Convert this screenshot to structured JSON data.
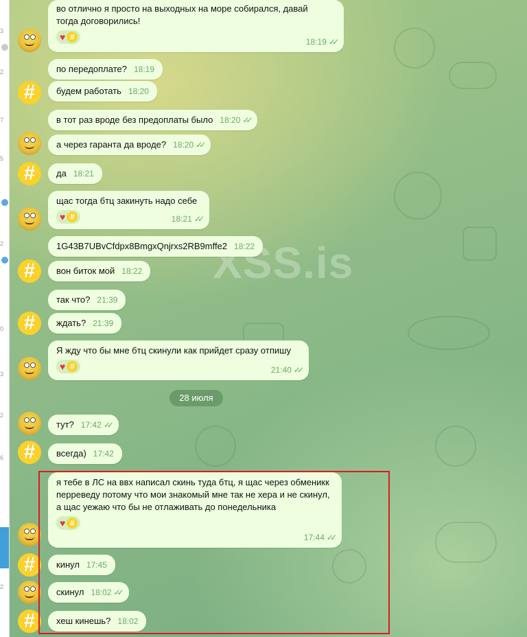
{
  "sidebar_strip": {
    "fragments": [
      "3",
      "2",
      "7",
      "5",
      "2",
      "0",
      "3",
      "2",
      "6",
      "2"
    ]
  },
  "watermark": "XSS.is",
  "date_separator": "28 июля",
  "highlight_color": "#e0191f",
  "messages": [
    {
      "id": "m1",
      "avatar": "sponge",
      "text": "во отлично я просто на выходных на море собирался, давай тогда договорились!",
      "time": "18:19",
      "read": true,
      "reactions": true
    },
    {
      "id": "m2",
      "avatar": null,
      "text": "по передоплате?",
      "time": "18:19",
      "read": false,
      "reactions": false
    },
    {
      "id": "m3",
      "avatar": "hash",
      "text": "будем работать",
      "time": "18:20",
      "read": false,
      "reactions": false
    },
    {
      "id": "m4",
      "avatar": null,
      "text": "в тот раз вроде без предоплаты было",
      "time": "18:20",
      "read": true,
      "reactions": false
    },
    {
      "id": "m5",
      "avatar": "sponge",
      "text": "а через гаранта да вроде?",
      "time": "18:20",
      "read": true,
      "reactions": false
    },
    {
      "id": "m6",
      "avatar": "hash",
      "text": "да",
      "time": "18:21",
      "read": false,
      "reactions": false
    },
    {
      "id": "m7",
      "avatar": "sponge",
      "text": "щас тогда бтц закинуть надо себе",
      "time": "18:21",
      "read": true,
      "reactions": true
    },
    {
      "id": "m8",
      "avatar": null,
      "text": "1G43B7UBvCfdpx8BmgxQnjrxs2RB9mffe2",
      "time": "18:22",
      "read": false,
      "reactions": false
    },
    {
      "id": "m9",
      "avatar": "hash",
      "text": "вон биток мой",
      "time": "18:22",
      "read": false,
      "reactions": false
    },
    {
      "id": "m10",
      "avatar": null,
      "text": "так что?",
      "time": "21:39",
      "read": false,
      "reactions": false
    },
    {
      "id": "m11",
      "avatar": "hash",
      "text": "ждать?",
      "time": "21:39",
      "read": false,
      "reactions": false
    },
    {
      "id": "m12",
      "avatar": "sponge",
      "text": "Я жду что бы мне бтц скинули как прийдет сразу отпишу",
      "time": "21:40",
      "read": true,
      "reactions": true
    },
    {
      "id": "m13",
      "avatar": "sponge",
      "text": "тут?",
      "time": "17:42",
      "read": true,
      "reactions": false
    },
    {
      "id": "m14",
      "avatar": "hash",
      "text": "всегда)",
      "time": "17:42",
      "read": false,
      "reactions": false
    },
    {
      "id": "m15",
      "avatar": "sponge",
      "text": "я тебе в ЛС на ввх написал скинь туда бтц, я щас через обменикк перреведу потому что мои знакомый мне так не хера и не скинул, а щас уежаю что бы не отлаживать до понедельника",
      "time": "17:44",
      "read": true,
      "reactions": true
    },
    {
      "id": "m16",
      "avatar": "hash",
      "text": "кинул",
      "time": "17:45",
      "read": false,
      "reactions": false
    },
    {
      "id": "m17",
      "avatar": "sponge",
      "text": "скинул",
      "time": "18:02",
      "read": true,
      "reactions": false
    },
    {
      "id": "m18",
      "avatar": "hash",
      "text": "хеш кинешь?",
      "time": "18:02",
      "read": false,
      "reactions": false
    }
  ]
}
